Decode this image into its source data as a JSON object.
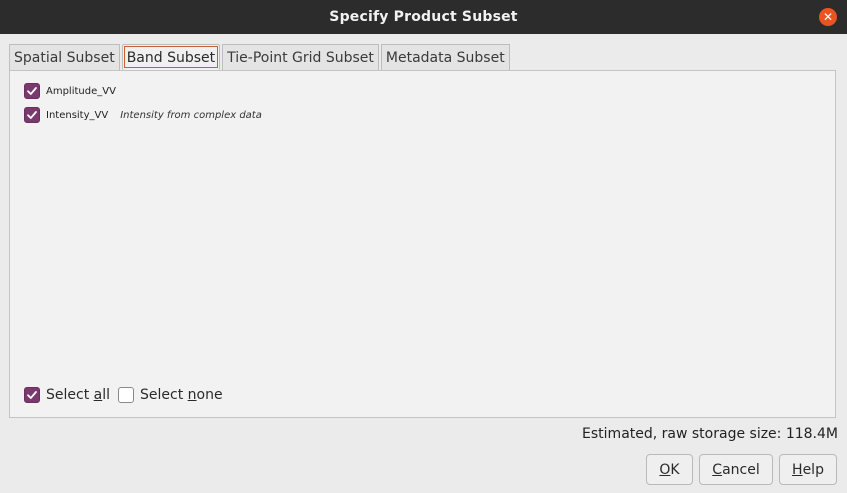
{
  "window": {
    "title": "Specify Product Subset"
  },
  "tabs": [
    {
      "label": "Spatial Subset"
    },
    {
      "label": "Band Subset"
    },
    {
      "label": "Tie-Point Grid Subset"
    },
    {
      "label": "Metadata Subset"
    }
  ],
  "active_tab": "Band Subset",
  "bands": [
    {
      "name": "Amplitude_VV",
      "checked": true,
      "description": ""
    },
    {
      "name": "Intensity_VV",
      "checked": true,
      "description": "Intensity from complex data"
    }
  ],
  "select_all": {
    "pre": "Select ",
    "mnemonic": "a",
    "post": "ll",
    "checked": true
  },
  "select_none": {
    "pre": "Select ",
    "mnemonic": "n",
    "post": "one",
    "checked": false
  },
  "storage": {
    "text": "Estimated, raw storage size: 118.4M"
  },
  "buttons": {
    "ok": {
      "mnemonic": "O",
      "rest": "K"
    },
    "cancel": {
      "mnemonic": "C",
      "rest": "ancel"
    },
    "help": {
      "mnemonic": "H",
      "rest": "elp"
    }
  },
  "colors": {
    "accent": "#7b3a6e",
    "close": "#e95420",
    "titlebar": "#2c2c2c"
  }
}
